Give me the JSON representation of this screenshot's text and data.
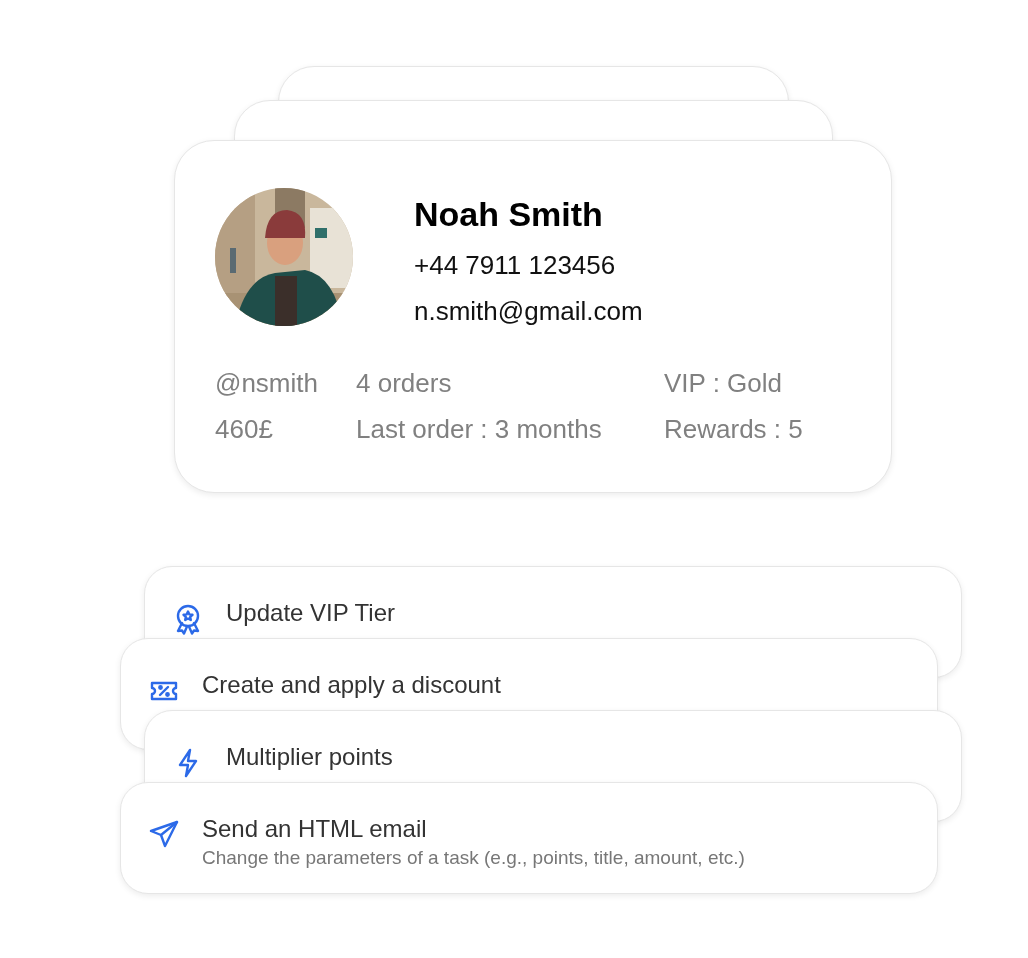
{
  "profile": {
    "name": "Noah Smith",
    "phone": "+44 7911 123456",
    "email": "n.smith@gmail.com",
    "stats": [
      "@nsmith",
      "4 orders",
      "VIP : Gold",
      "460£",
      "Last order : 3 months",
      "Rewards : 5"
    ]
  },
  "actions": [
    {
      "kind": "award",
      "title": "Update VIP Tier"
    },
    {
      "kind": "discount",
      "title": "Create and apply a discount"
    },
    {
      "kind": "lightning",
      "title": "Multiplier points"
    },
    {
      "kind": "send",
      "title": "Send an HTML email",
      "subtitle": "Change the parameters of a task (e.g., points, title, amount, etc.)"
    }
  ]
}
